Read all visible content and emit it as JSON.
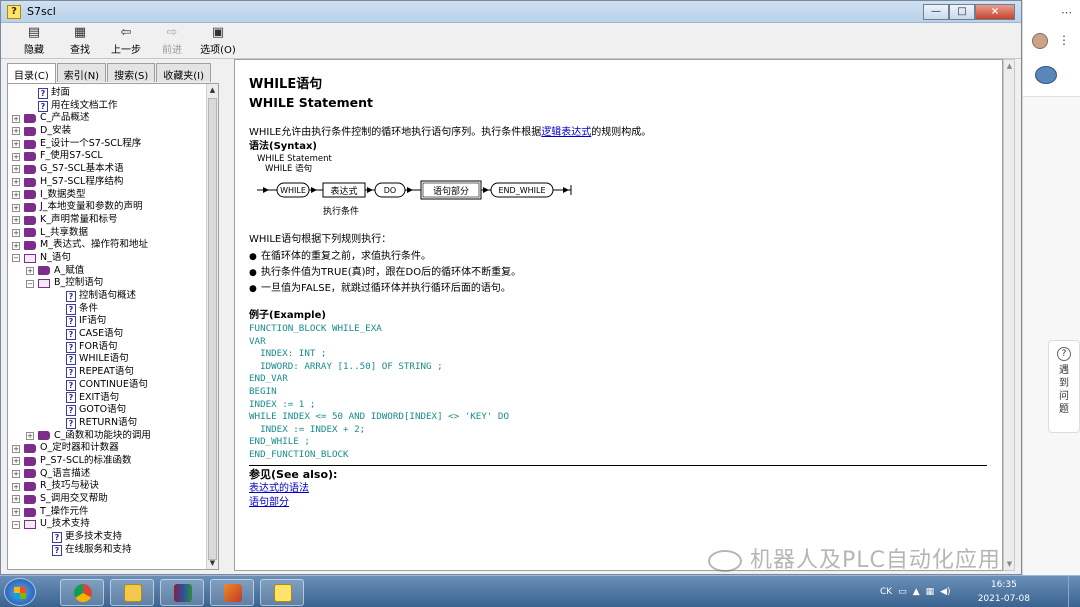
{
  "window": {
    "title": "S7scl",
    "app_icon": "?"
  },
  "toolbar": {
    "items": [
      {
        "label": "隐藏",
        "icon": "hide-icon"
      },
      {
        "label": "查找",
        "icon": "find-icon"
      },
      {
        "label": "上一步",
        "icon": "back-icon"
      },
      {
        "label": "前进",
        "icon": "forward-icon",
        "disabled": true
      },
      {
        "label": "选项(O)",
        "icon": "options-icon"
      }
    ]
  },
  "tabs": [
    "目录(C)",
    "索引(N)",
    "搜索(S)",
    "收藏夹(I)"
  ],
  "tree": [
    {
      "label": "封面",
      "type": "page",
      "depth": 1
    },
    {
      "label": "用在线文档工作",
      "type": "page",
      "depth": 1
    },
    {
      "label": "C_产品概述",
      "type": "book",
      "depth": 0
    },
    {
      "label": "D_安装",
      "type": "book",
      "depth": 0
    },
    {
      "label": "E_设计一个S7-SCL程序",
      "type": "book",
      "depth": 0
    },
    {
      "label": "F_使用S7-SCL",
      "type": "book",
      "depth": 0
    },
    {
      "label": "G_S7-SCL基本术语",
      "type": "book",
      "depth": 0
    },
    {
      "label": "H_S7-SCL程序结构",
      "type": "book",
      "depth": 0
    },
    {
      "label": "I_数据类型",
      "type": "book",
      "depth": 0
    },
    {
      "label": "J_本地变量和参数的声明",
      "type": "book",
      "depth": 0
    },
    {
      "label": "K_声明常量和标号",
      "type": "book",
      "depth": 0
    },
    {
      "label": "L_共享数据",
      "type": "book",
      "depth": 0
    },
    {
      "label": "M_表达式、操作符和地址",
      "type": "book",
      "depth": 0
    },
    {
      "label": "N_语句",
      "type": "openbook",
      "depth": 0
    },
    {
      "label": "A_赋值",
      "type": "book",
      "depth": 1
    },
    {
      "label": "B_控制语句",
      "type": "openbook",
      "depth": 1
    },
    {
      "label": "控制语句概述",
      "type": "page",
      "depth": 3
    },
    {
      "label": "条件",
      "type": "page",
      "depth": 3
    },
    {
      "label": "IF语句",
      "type": "page",
      "depth": 3
    },
    {
      "label": "CASE语句",
      "type": "page",
      "depth": 3
    },
    {
      "label": "FOR语句",
      "type": "page",
      "depth": 3
    },
    {
      "label": "WHILE语句",
      "type": "page",
      "depth": 3
    },
    {
      "label": "REPEAT语句",
      "type": "page",
      "depth": 3
    },
    {
      "label": "CONTINUE语句",
      "type": "page",
      "depth": 3
    },
    {
      "label": "EXIT语句",
      "type": "page",
      "depth": 3
    },
    {
      "label": "GOTO语句",
      "type": "page",
      "depth": 3
    },
    {
      "label": "RETURN语句",
      "type": "page",
      "depth": 3
    },
    {
      "label": "C_函数和功能块的调用",
      "type": "book",
      "depth": 1
    },
    {
      "label": "O_定时器和计数器",
      "type": "book",
      "depth": 0
    },
    {
      "label": "P_S7-SCL的标准函数",
      "type": "book",
      "depth": 0
    },
    {
      "label": "Q_语言描述",
      "type": "book",
      "depth": 0
    },
    {
      "label": "R_技巧与秘诀",
      "type": "book",
      "depth": 0
    },
    {
      "label": "S_调用交叉帮助",
      "type": "book",
      "depth": 0
    },
    {
      "label": "T_操作元件",
      "type": "book",
      "depth": 0
    },
    {
      "label": "U_技术支持",
      "type": "openbook",
      "depth": 0
    },
    {
      "label": "更多技术支持",
      "type": "page",
      "depth": 2
    },
    {
      "label": "在线服务和支持",
      "type": "page",
      "depth": 2
    }
  ],
  "content": {
    "title_cn": "WHILE语句",
    "title_en": "WHILE Statement",
    "intro": "WHILE允许由执行条件控制的循环地执行语句序列。执行条件根据",
    "intro_link": "逻辑表达式",
    "intro_tail": "的规则构成。",
    "syntax_heading": "语法(Syntax)",
    "diagram": {
      "caption1": "WHILE Statement",
      "caption2": "WHILE 语句",
      "boxes": [
        "WHILE",
        "表达式",
        "DO",
        "语句部分",
        "END_WHILE"
      ],
      "sublabel": "执行条件"
    },
    "rules_intro": "WHILE语句根据下列规则执行：",
    "rules": [
      "在循环体的重复之前，求值执行条件。",
      "执行条件值为TRUE(真)时，跟在DO后的循环体不断重复。",
      "一旦值为FALSE，就跳过循环体并执行循环后面的语句。"
    ],
    "example_heading": "例子(Example)",
    "code": [
      "FUNCTION_BLOCK WHILE_EXA",
      "VAR",
      "  INDEX: INT ;",
      "  IDWORD: ARRAY [1..50] OF STRING ;",
      "END_VAR",
      "BEGIN",
      "INDEX := 1 ;",
      "WHILE INDEX <= 50 AND IDWORD[INDEX] <> 'KEY' DO",
      "  INDEX := INDEX + 2;",
      "END_WHILE ;",
      "END_FUNCTION_BLOCK"
    ],
    "see_also_heading": "参见(See also):",
    "see_also": [
      "表达式的语法",
      "语句部分"
    ]
  },
  "sidebar_right": {
    "help_label": "遇到问题",
    "help_icon": "?"
  },
  "watermark": "机器人及PLC自动化应用",
  "taskbar": {
    "clock_time": "16:35",
    "clock_date": "2021-07-08",
    "lang": "CK",
    "apps": [
      "chrome-icon",
      "explorer-icon",
      "archive-icon",
      "matlab-icon",
      "help-icon"
    ]
  },
  "accents": {
    "code_color": "#1a8c8c",
    "link_color": "#0000cc",
    "book_color": "#7c2d8c"
  }
}
